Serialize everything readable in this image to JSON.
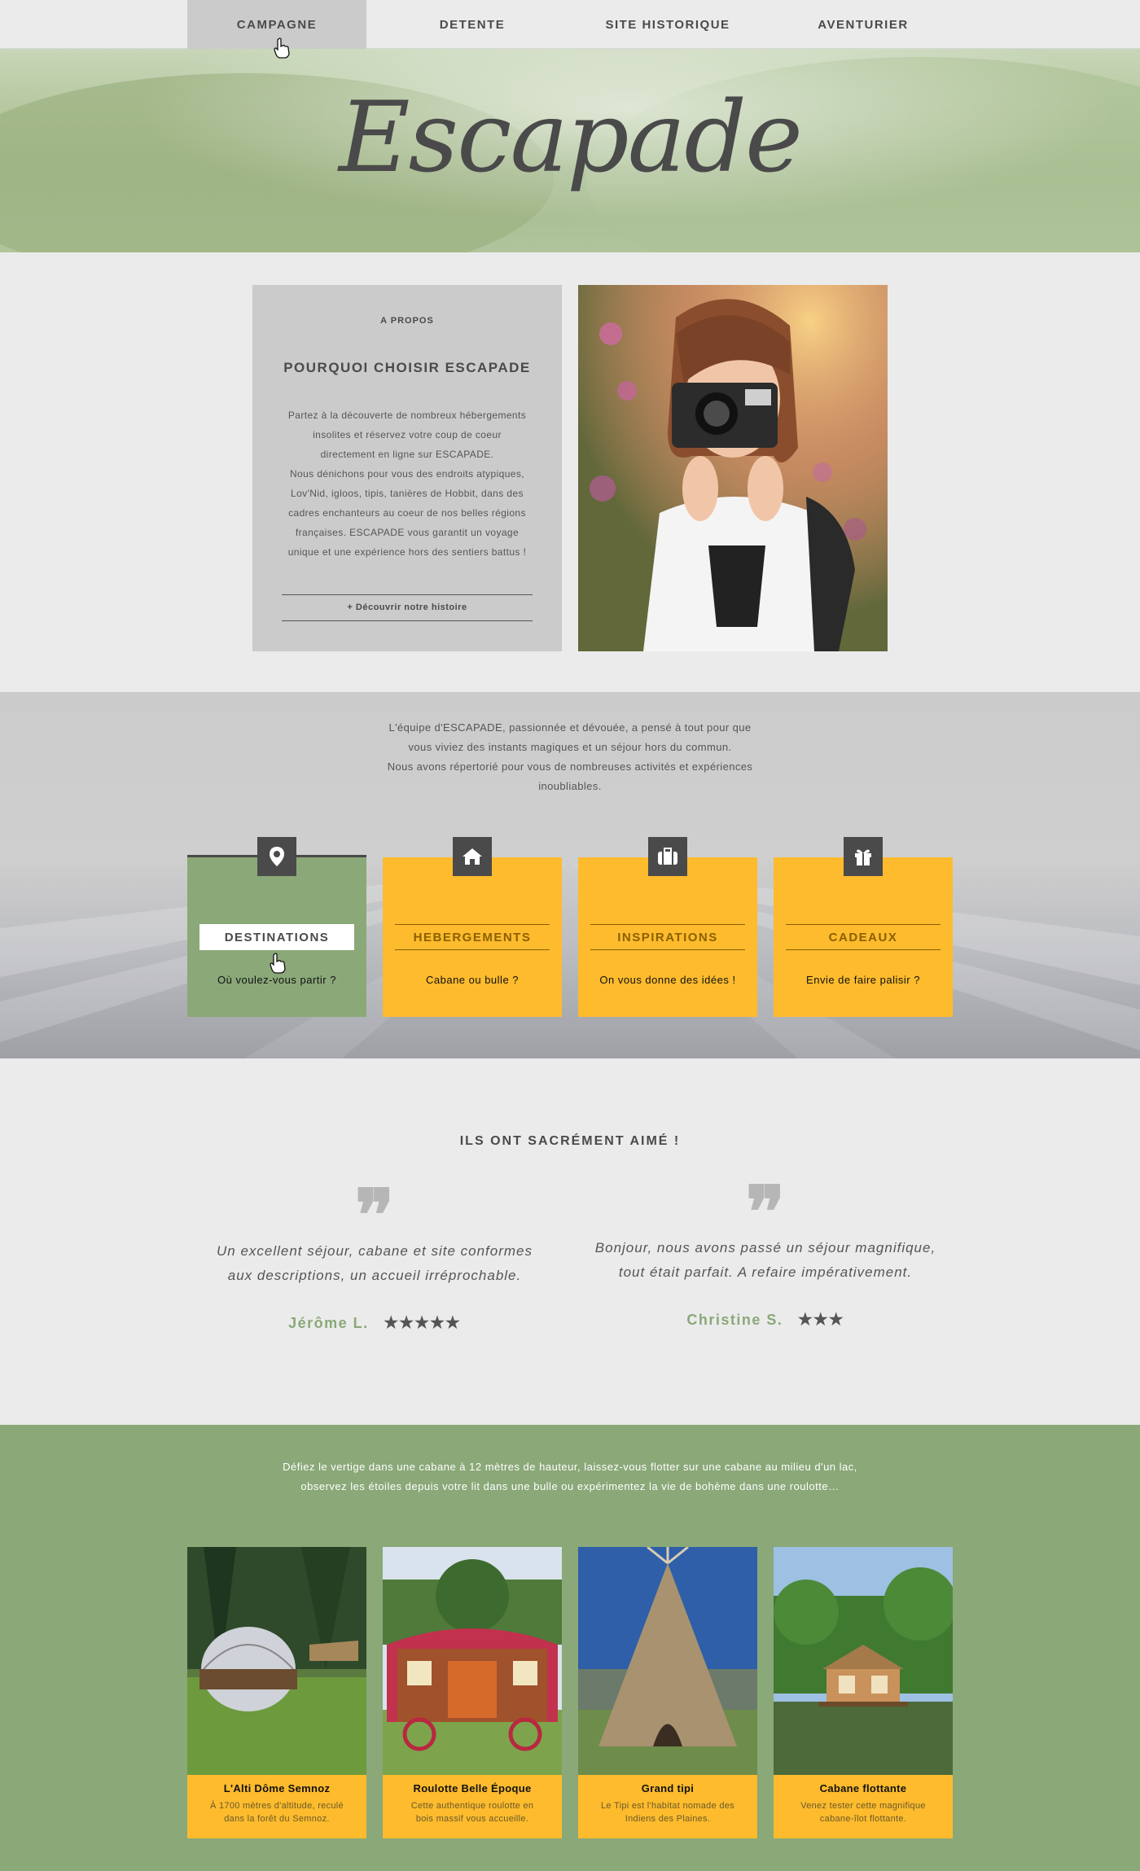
{
  "nav": {
    "items": [
      {
        "label": "CAMPAGNE",
        "active": true
      },
      {
        "label": "DETENTE",
        "active": false
      },
      {
        "label": "SITE HISTORIQUE",
        "active": false
      },
      {
        "label": "AVENTURIER",
        "active": false
      }
    ]
  },
  "hero": {
    "logo": "Escapade"
  },
  "about": {
    "kicker": "A PROPOS",
    "title": "POURQUOI CHOISIR ESCAPADE",
    "lines": [
      "Partez à la découverte de nombreux hébergements",
      "insolites et réservez votre coup de coeur",
      "directement en ligne sur ESCAPADE.",
      "Nous dénichons pour vous des endroits atypiques,",
      "Lov'Nid, igloos, tipis, tanières de Hobbit, dans des",
      "cadres enchanteurs au coeur de nos belles régions",
      "françaises. ESCAPADE vous garantit un voyage",
      "unique et une expérience hors des sentiers battus !"
    ],
    "link": "+ Découvrir notre histoire"
  },
  "categories": {
    "intro_lines": [
      "L'équipe d'ESCAPADE, passionnée et dévouée, a pensé à tout pour que",
      "vous viviez des instants magiques et un séjour hors du commun.",
      "Nous avons répertorié pour vous de nombreuses activités et expériences",
      "inoubliables."
    ],
    "items": [
      {
        "label": "DESTINATIONS",
        "sub": "Où voulez-vous partir ?",
        "icon": "map-pin-icon",
        "color": "#8aa878"
      },
      {
        "label": "HEBERGEMENTS",
        "sub": "Cabane ou bulle ?",
        "icon": "home-icon",
        "color": "#fdbb2d"
      },
      {
        "label": "INSPIRATIONS",
        "sub": "On vous donne des idées !",
        "icon": "suitcase-icon",
        "color": "#fdbb2d"
      },
      {
        "label": "CADEAUX",
        "sub": "Envie de faire palisir ?",
        "icon": "gift-icon",
        "color": "#fdbb2d"
      }
    ]
  },
  "reviews": {
    "title": "ILS ONT SACRÉMENT AIMÉ !",
    "items": [
      {
        "lines": [
          "Un excellent séjour, cabane et site conformes",
          "aux descriptions, un accueil irréprochable."
        ],
        "author": "Jérôme L.",
        "stars": "★★★★★",
        "rating": 5
      },
      {
        "lines": [
          "Bonjour, nous avons passé un séjour magnifique,",
          "tout était parfait. A refaire impérativement."
        ],
        "author": "Christine S.",
        "stars": "★★★",
        "rating": 3
      }
    ]
  },
  "stays": {
    "intro_lines": [
      "Défiez le vertige dans une cabane à 12 mètres de hauteur, laissez-vous flotter sur une cabane au milieu d'un lac,",
      "observez les étoiles depuis votre lit dans une bulle ou expérimentez la vie de bohème dans une roulotte…"
    ],
    "items": [
      {
        "title": "L'Alti Dôme Semnoz",
        "desc": [
          "À 1700 mètres d'altitude, reculé",
          "dans la forêt du Semnoz."
        ]
      },
      {
        "title": "Roulotte Belle Époque",
        "desc": [
          "Cette authentique roulotte en",
          "bois massif vous accueille."
        ]
      },
      {
        "title": "Grand tipi",
        "desc": [
          "Le Tipi est l'habitat nomade des",
          "Indiens des Plaines."
        ]
      },
      {
        "title": "Cabane flottante",
        "desc": [
          "Venez tester cette magnifique",
          "cabane-îlot flottante."
        ]
      }
    ]
  },
  "colors": {
    "green": "#8aa878",
    "yellow": "#fdbb2d",
    "dark": "#4a4a4a",
    "light": "#ebebeb"
  }
}
